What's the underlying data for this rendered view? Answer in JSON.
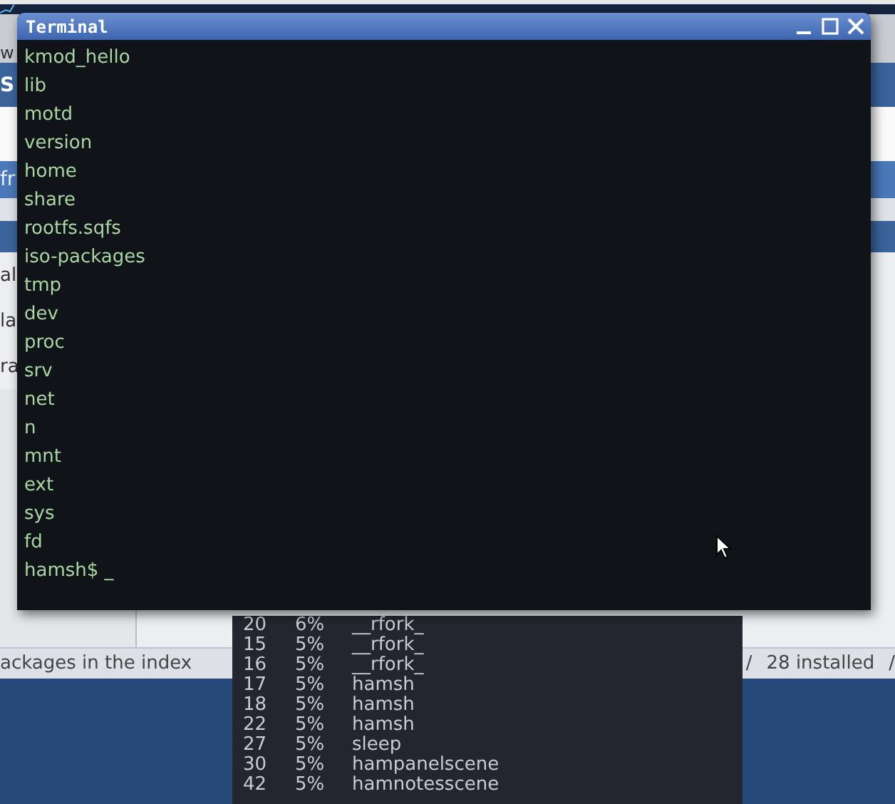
{
  "background_window": {
    "title": "w",
    "header": "S",
    "button": "fr",
    "rows": [
      "al",
      "la",
      "ra"
    ],
    "status_bar": {
      "left": "ackages in the index",
      "separator_1": "/",
      "installed": "28 installed",
      "separator_2": "/"
    }
  },
  "process_list": [
    {
      "pid": "20",
      "cpu": "6%",
      "name": "__rfork_"
    },
    {
      "pid": "15",
      "cpu": "5%",
      "name": "__rfork_"
    },
    {
      "pid": "16",
      "cpu": "5%",
      "name": "__rfork_"
    },
    {
      "pid": "17",
      "cpu": "5%",
      "name": "hamsh"
    },
    {
      "pid": "18",
      "cpu": "5%",
      "name": "hamsh"
    },
    {
      "pid": "22",
      "cpu": "5%",
      "name": "hamsh"
    },
    {
      "pid": "27",
      "cpu": "5%",
      "name": "sleep"
    },
    {
      "pid": "30",
      "cpu": "5%",
      "name": "hampanelscene"
    },
    {
      "pid": "42",
      "cpu": "5%",
      "name": "hamnotesscene"
    }
  ],
  "terminal": {
    "title": "Terminal",
    "lines": [
      "kmod_hello",
      "lib",
      "motd",
      "version",
      "home",
      "share",
      "rootfs.sqfs",
      "iso-packages",
      "tmp",
      "dev",
      "proc",
      "srv",
      "net",
      "n",
      "mnt",
      "ext",
      "sys",
      "fd"
    ],
    "prompt": "hamsh$ _"
  }
}
